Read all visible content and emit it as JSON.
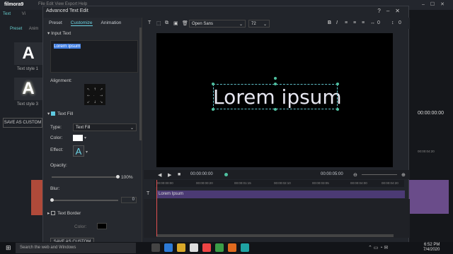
{
  "background_app": {
    "logo": "filmora9",
    "menu": "File   Edit   View   Export   Help",
    "left_tabs": [
      "Text",
      "Vi"
    ],
    "left_subtabs": [
      "Preset",
      "Anim"
    ],
    "styles": [
      {
        "glyph": "A",
        "label": "Text style 1"
      },
      {
        "glyph": "A",
        "label": "Text style 3"
      }
    ],
    "save_custom_label": "SAVE AS CUSTOM",
    "right_time": "00:00:00:00",
    "ruler_right": "00:00:04:20"
  },
  "dialog": {
    "title": "Advanced Text Edit",
    "tabs": [
      "Preset",
      "Customize",
      "Animation"
    ],
    "active_tab": "Customize",
    "input_text_header": "Input Text",
    "input_text_value": "Lorem ipsum",
    "alignment_label": "Alignment:",
    "text_fill": {
      "header": "Text Fill",
      "checked": true,
      "type_label": "Type:",
      "type_value": "Text Fill",
      "color_label": "Color:",
      "color_value": "#ffffff",
      "effect_label": "Effect:",
      "effect_glyph": "A",
      "opacity_label": "Opacity:",
      "opacity_value": "100%",
      "opacity_fraction": 1.0,
      "blur_label": "Blur:",
      "blur_value": "0"
    },
    "text_border": {
      "header": "Text Border",
      "checked": false,
      "color_label": "Color:"
    },
    "save_custom_bottom": "SAVE AS CUSTOM",
    "toolbar": {
      "font": "Open Sans",
      "size": "72",
      "spacing_a": "0",
      "spacing_b": "0"
    },
    "preview_text": "Lorem ipsum",
    "transport": {
      "current_time": "00:00:00:00",
      "duration": "00:00:05:00"
    },
    "ruler": [
      "00:00:00:00",
      "00:00:00:20",
      "00:00:01:15",
      "00:00:02:10",
      "00:00:03:05",
      "00:00:04:00",
      "00:00:04:20"
    ],
    "track_label": "Lorem Ipsum"
  },
  "taskbar": {
    "search_placeholder": "Search the web and Windows",
    "time": "6:52 PM",
    "date": "7/4/2020"
  },
  "colors": {
    "accent": "#6cd6e6",
    "track": "#4b3a74",
    "selection": "#3d7be0"
  }
}
